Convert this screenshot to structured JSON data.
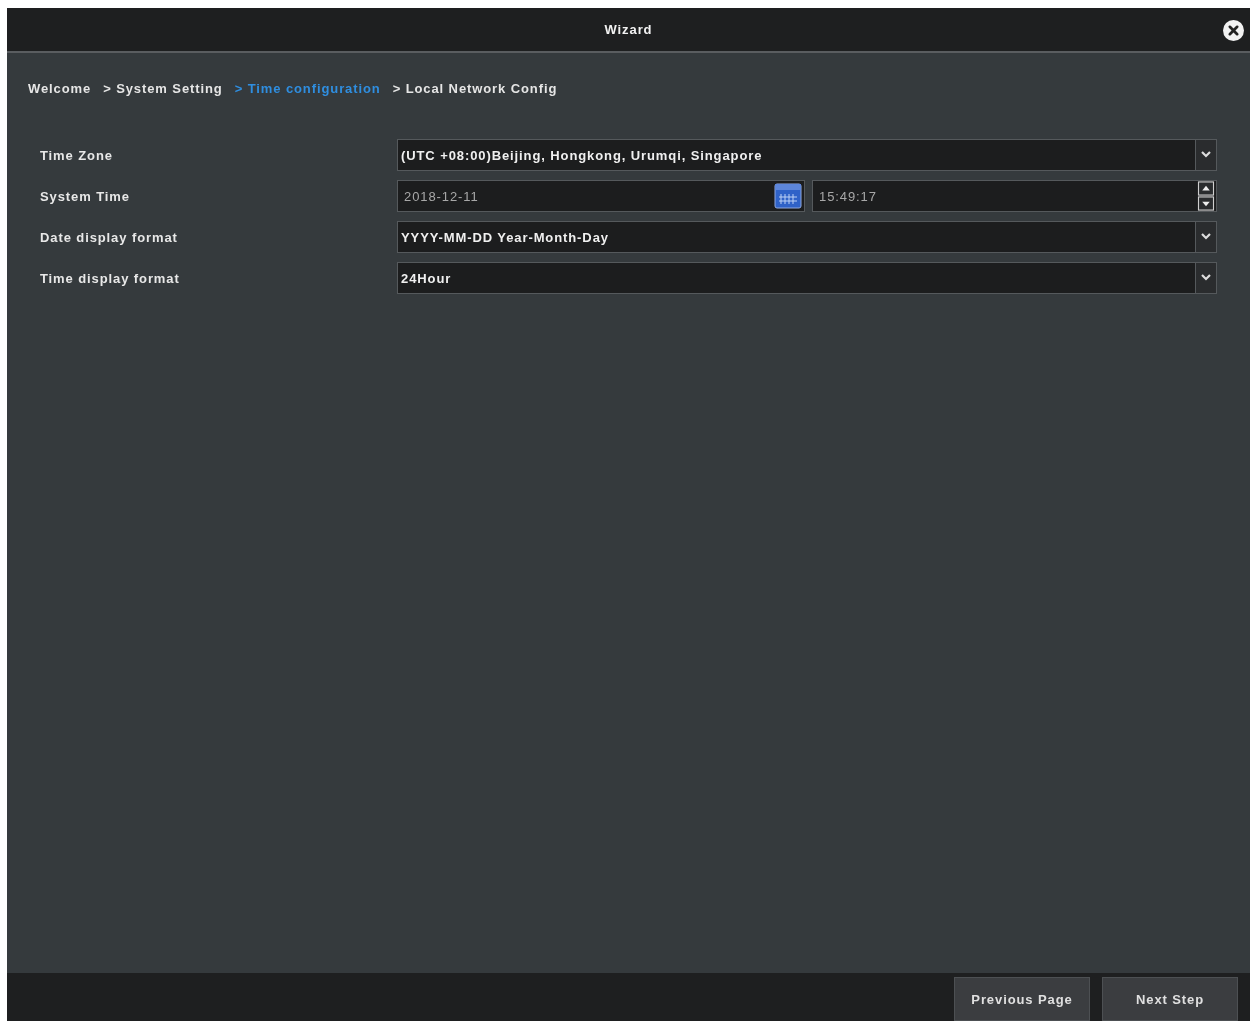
{
  "window": {
    "title": "Wizard"
  },
  "breadcrumb": [
    {
      "label": "Welcome",
      "selected": false
    },
    {
      "label": "> System Setting",
      "selected": false
    },
    {
      "label": "> Time configuration",
      "selected": true
    },
    {
      "label": "> Local Network Config",
      "selected": false
    }
  ],
  "fields": [
    {
      "kind": "select",
      "label": "Time Zone",
      "value": "(UTC +08:00)Beijing, Hongkong, Urumqi, Singapore"
    },
    {
      "kind": "datetime",
      "label": "System Time",
      "date": "2018-12-11",
      "time": "15:49:17"
    },
    {
      "kind": "select",
      "label": "Date display format",
      "value": "YYYY-MM-DD Year-Month-Day"
    },
    {
      "kind": "select",
      "label": "Time display format",
      "value": "24Hour"
    }
  ],
  "buttons": [
    "Previous Page",
    "Next Step"
  ]
}
